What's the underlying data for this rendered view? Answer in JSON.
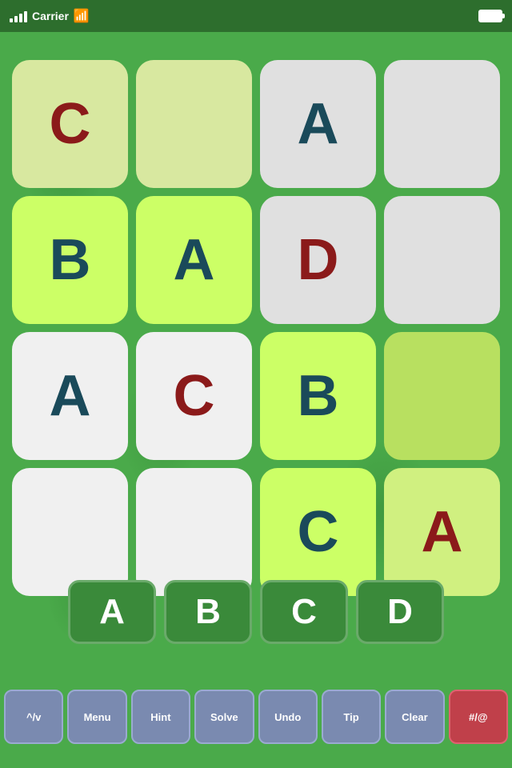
{
  "statusBar": {
    "carrier": "Carrier",
    "batteryIcon": "🔋"
  },
  "grid": {
    "cells": [
      {
        "id": 0,
        "letter": "C",
        "color": "cell-light-yellow",
        "letterColor": "letter-dark-red"
      },
      {
        "id": 1,
        "letter": "",
        "color": "cell-light-yellow",
        "letterColor": ""
      },
      {
        "id": 2,
        "letter": "A",
        "color": "cell-gray",
        "letterColor": "letter-dark-teal"
      },
      {
        "id": 3,
        "letter": "",
        "color": "cell-gray",
        "letterColor": ""
      },
      {
        "id": 4,
        "letter": "B",
        "color": "cell-light-green-bright",
        "letterColor": "letter-dark-teal"
      },
      {
        "id": 5,
        "letter": "A",
        "color": "cell-light-green-bright",
        "letterColor": "letter-dark-teal"
      },
      {
        "id": 6,
        "letter": "D",
        "color": "cell-gray",
        "letterColor": "letter-dark-red"
      },
      {
        "id": 7,
        "letter": "",
        "color": "cell-gray",
        "letterColor": ""
      },
      {
        "id": 8,
        "letter": "A",
        "color": "cell-white",
        "letterColor": "letter-dark-teal"
      },
      {
        "id": 9,
        "letter": "C",
        "color": "cell-white",
        "letterColor": "letter-dark-red"
      },
      {
        "id": 10,
        "letter": "B",
        "color": "cell-light-green-bright",
        "letterColor": "letter-dark-teal"
      },
      {
        "id": 11,
        "letter": "",
        "color": "cell-green-medium",
        "letterColor": ""
      },
      {
        "id": 12,
        "letter": "",
        "color": "cell-white",
        "letterColor": ""
      },
      {
        "id": 13,
        "letter": "",
        "color": "cell-white",
        "letterColor": ""
      },
      {
        "id": 14,
        "letter": "C",
        "color": "cell-light-green-bright",
        "letterColor": "letter-dark-teal"
      },
      {
        "id": 15,
        "letter": "A",
        "color": "cell-light-green",
        "letterColor": "letter-dark-red"
      }
    ]
  },
  "letterButtons": [
    "A",
    "B",
    "C",
    "D"
  ],
  "actionButtons": [
    {
      "label": "^/v",
      "id": "sort-btn",
      "special": false
    },
    {
      "label": "Menu",
      "id": "menu-btn",
      "special": false
    },
    {
      "label": "Hint",
      "id": "hint-btn",
      "special": false
    },
    {
      "label": "Solve",
      "id": "solve-btn",
      "special": false
    },
    {
      "label": "Undo",
      "id": "undo-btn",
      "special": false
    },
    {
      "label": "Tip",
      "id": "tip-btn",
      "special": false
    },
    {
      "label": "Clear",
      "id": "clear-btn",
      "special": false
    },
    {
      "label": "#/@",
      "id": "symbol-btn",
      "special": true
    }
  ]
}
